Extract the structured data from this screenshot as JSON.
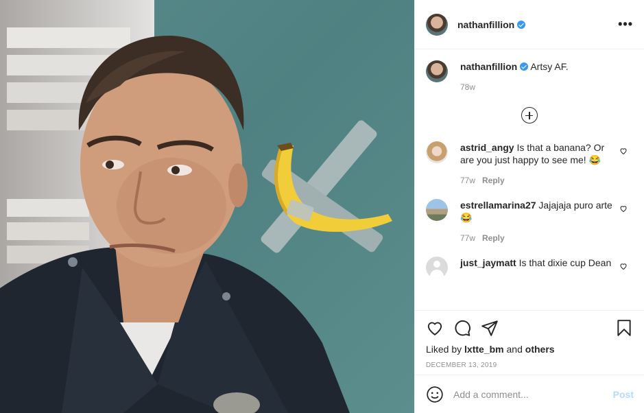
{
  "post": {
    "author": "nathanfillion",
    "caption": "Artsy AF.",
    "caption_age": "78w",
    "liked_by_prefix": "Liked by ",
    "liked_by_user": "lxtte_bm",
    "liked_by_and": " and ",
    "liked_by_others": "others",
    "date": "DECEMBER 13, 2019"
  },
  "header": {
    "username": "nathanfillion",
    "more_icon": "more-horizontal-icon"
  },
  "comments": [
    {
      "username": "astrid_angy",
      "text": "Is that a banana? Or are you just happy to see me! 😂",
      "age": "77w",
      "reply": "Reply"
    },
    {
      "username": "estrellamarina27",
      "text": "Jajajaja puro arte😂",
      "age": "77w",
      "reply": "Reply"
    },
    {
      "username": "just_jaymatt",
      "text": "Is that dixie cup Dean",
      "age": "",
      "reply": ""
    }
  ],
  "actions": {
    "icons": [
      "heart-icon",
      "comment-icon",
      "share-icon",
      "bookmark-icon"
    ]
  },
  "add_comment": {
    "placeholder": "Add a comment...",
    "post_label": "Post",
    "post_color": "#b3dbff"
  },
  "colors": {
    "verified": "#3897f0",
    "text_primary": "#262626",
    "text_secondary": "#8e8e8e",
    "photo_wall": "#53878a"
  }
}
